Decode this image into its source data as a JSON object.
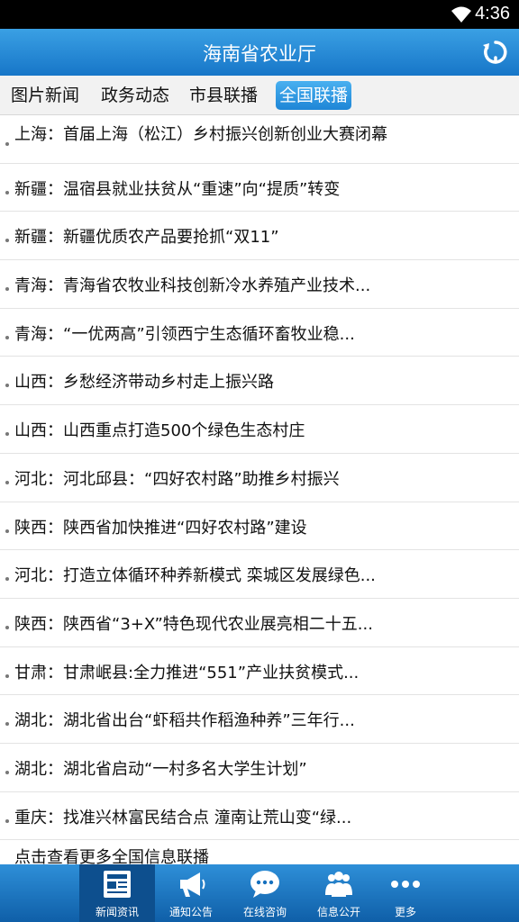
{
  "status_bar": {
    "time": "4:36"
  },
  "header": {
    "title": "海南省农业厅"
  },
  "tabs": [
    {
      "label": "图片新闻"
    },
    {
      "label": "政务动态"
    },
    {
      "label": "市县联播"
    },
    {
      "label": "全国联播",
      "active": true
    }
  ],
  "news": [
    "上海：首届上海（松江）乡村振兴创新创业大赛闭幕",
    "新疆：温宿县就业扶贫从“重速”向“提质”转变",
    "新疆：新疆优质农产品要抢抓“双11”",
    "青海：青海省农牧业科技创新冷水养殖产业技术...",
    "青海：“一优两高”引领西宁生态循环畜牧业稳...",
    "山西：乡愁经济带动乡村走上振兴路",
    "山西：山西重点打造500个绿色生态村庄",
    "河北：河北邱县：“四好农村路”助推乡村振兴",
    "陕西：陕西省加快推进“四好农村路”建设",
    "河北：打造立体循环种养新模式 栾城区发展绿色...",
    "陕西：陕西省“3+X”特色现代农业展亮相二十五...",
    "甘肃：甘肃岷县:全力推进“551”产业扶贫模式...",
    "湖北：湖北省出台“虾稻共作稻渔种养”三年行...",
    "湖北：湖北省启动“一村多名大学生计划”",
    "重庆：找准兴林富民结合点 潼南让荒山变“绿..."
  ],
  "more_link": "点击查看更多全国信息联播",
  "bottom_nav": [
    {
      "label": "新闻资讯",
      "icon": "news-icon",
      "active": true
    },
    {
      "label": "通知公告",
      "icon": "megaphone-icon"
    },
    {
      "label": "在线咨询",
      "icon": "chat-bubble-icon"
    },
    {
      "label": "信息公开",
      "icon": "people-icon"
    },
    {
      "label": "更多",
      "icon": "more-dots-icon"
    }
  ],
  "colors": {
    "accent": "#1e86d6",
    "nav_bg": "#1570be",
    "nav_active": "#0d4f8e"
  }
}
